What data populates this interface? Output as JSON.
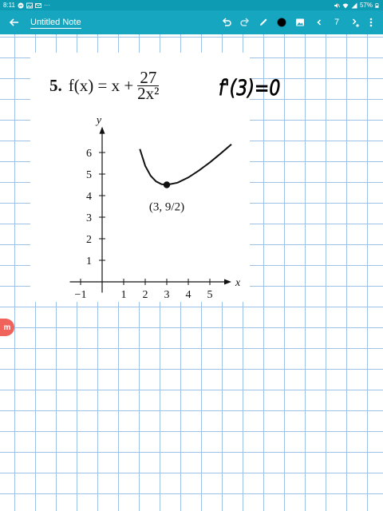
{
  "status_bar": {
    "time": "8:11",
    "notification_icons": [
      "messenger-icon",
      "gallery-icon",
      "mail-icon"
    ],
    "more": "···",
    "battery_percent": "57%"
  },
  "toolbar": {
    "title": "Untitled Note",
    "page_number": "7",
    "pen_color": "#000000"
  },
  "problem": {
    "number": "5.",
    "lhs": "f(x) = x +",
    "numerator": "27",
    "denominator": "2x²"
  },
  "handwriting": {
    "text": "f'(3)=0"
  },
  "chart_data": {
    "type": "line",
    "xlabel": "x",
    "ylabel": "y",
    "x_ticks": [
      "−1",
      "1",
      "2",
      "3",
      "4",
      "5"
    ],
    "y_ticks": [
      "1",
      "2",
      "3",
      "4",
      "5",
      "6"
    ],
    "xlim": [
      -1.5,
      6
    ],
    "ylim": [
      -0.5,
      7.2
    ],
    "series": [
      {
        "x": [
          1.75,
          2,
          2.25,
          2.5,
          2.75,
          3,
          3.5,
          4,
          4.5,
          5,
          5.5,
          6
        ],
        "y": [
          6.16,
          5.38,
          4.92,
          4.66,
          4.53,
          4.5,
          4.6,
          4.84,
          5.17,
          5.54,
          5.95,
          6.38
        ]
      }
    ],
    "annotation": {
      "x": 3,
      "y": 4.5,
      "label": "(3, 9/2)"
    }
  },
  "colors": {
    "status_bar": "#0c9bb3",
    "toolbar": "#16a6bf",
    "grid": "#9ec2e6",
    "badge": "#f0635a"
  }
}
